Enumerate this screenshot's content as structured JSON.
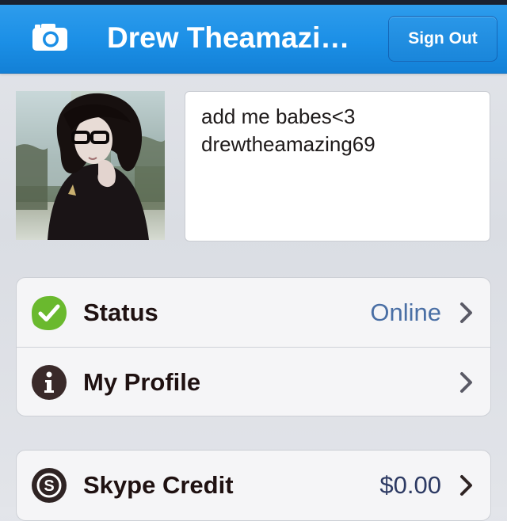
{
  "navbar": {
    "title": "Drew Theamazi…",
    "camera_icon": "camera-icon",
    "sign_out_label": "Sign Out"
  },
  "profile": {
    "avatar_icon": "profile-photo",
    "mood_lines": [
      "add me babes<3",
      "drewtheamazing69"
    ]
  },
  "menu": {
    "status": {
      "label": "Status",
      "value": "Online",
      "icon": "status-online-check-icon",
      "icon_color": "#6ab92e"
    },
    "my_profile": {
      "label": "My Profile",
      "icon": "info-icon",
      "icon_color": "#3a2a2a"
    },
    "skype_credit": {
      "label": "Skype Credit",
      "value": "$0.00",
      "icon": "skype-credit-icon",
      "icon_color": "#2f2424"
    }
  },
  "colors": {
    "nav_blue": "#1b8fe6",
    "value_blue": "#4a6fa5",
    "background": "#e0e2e7"
  }
}
